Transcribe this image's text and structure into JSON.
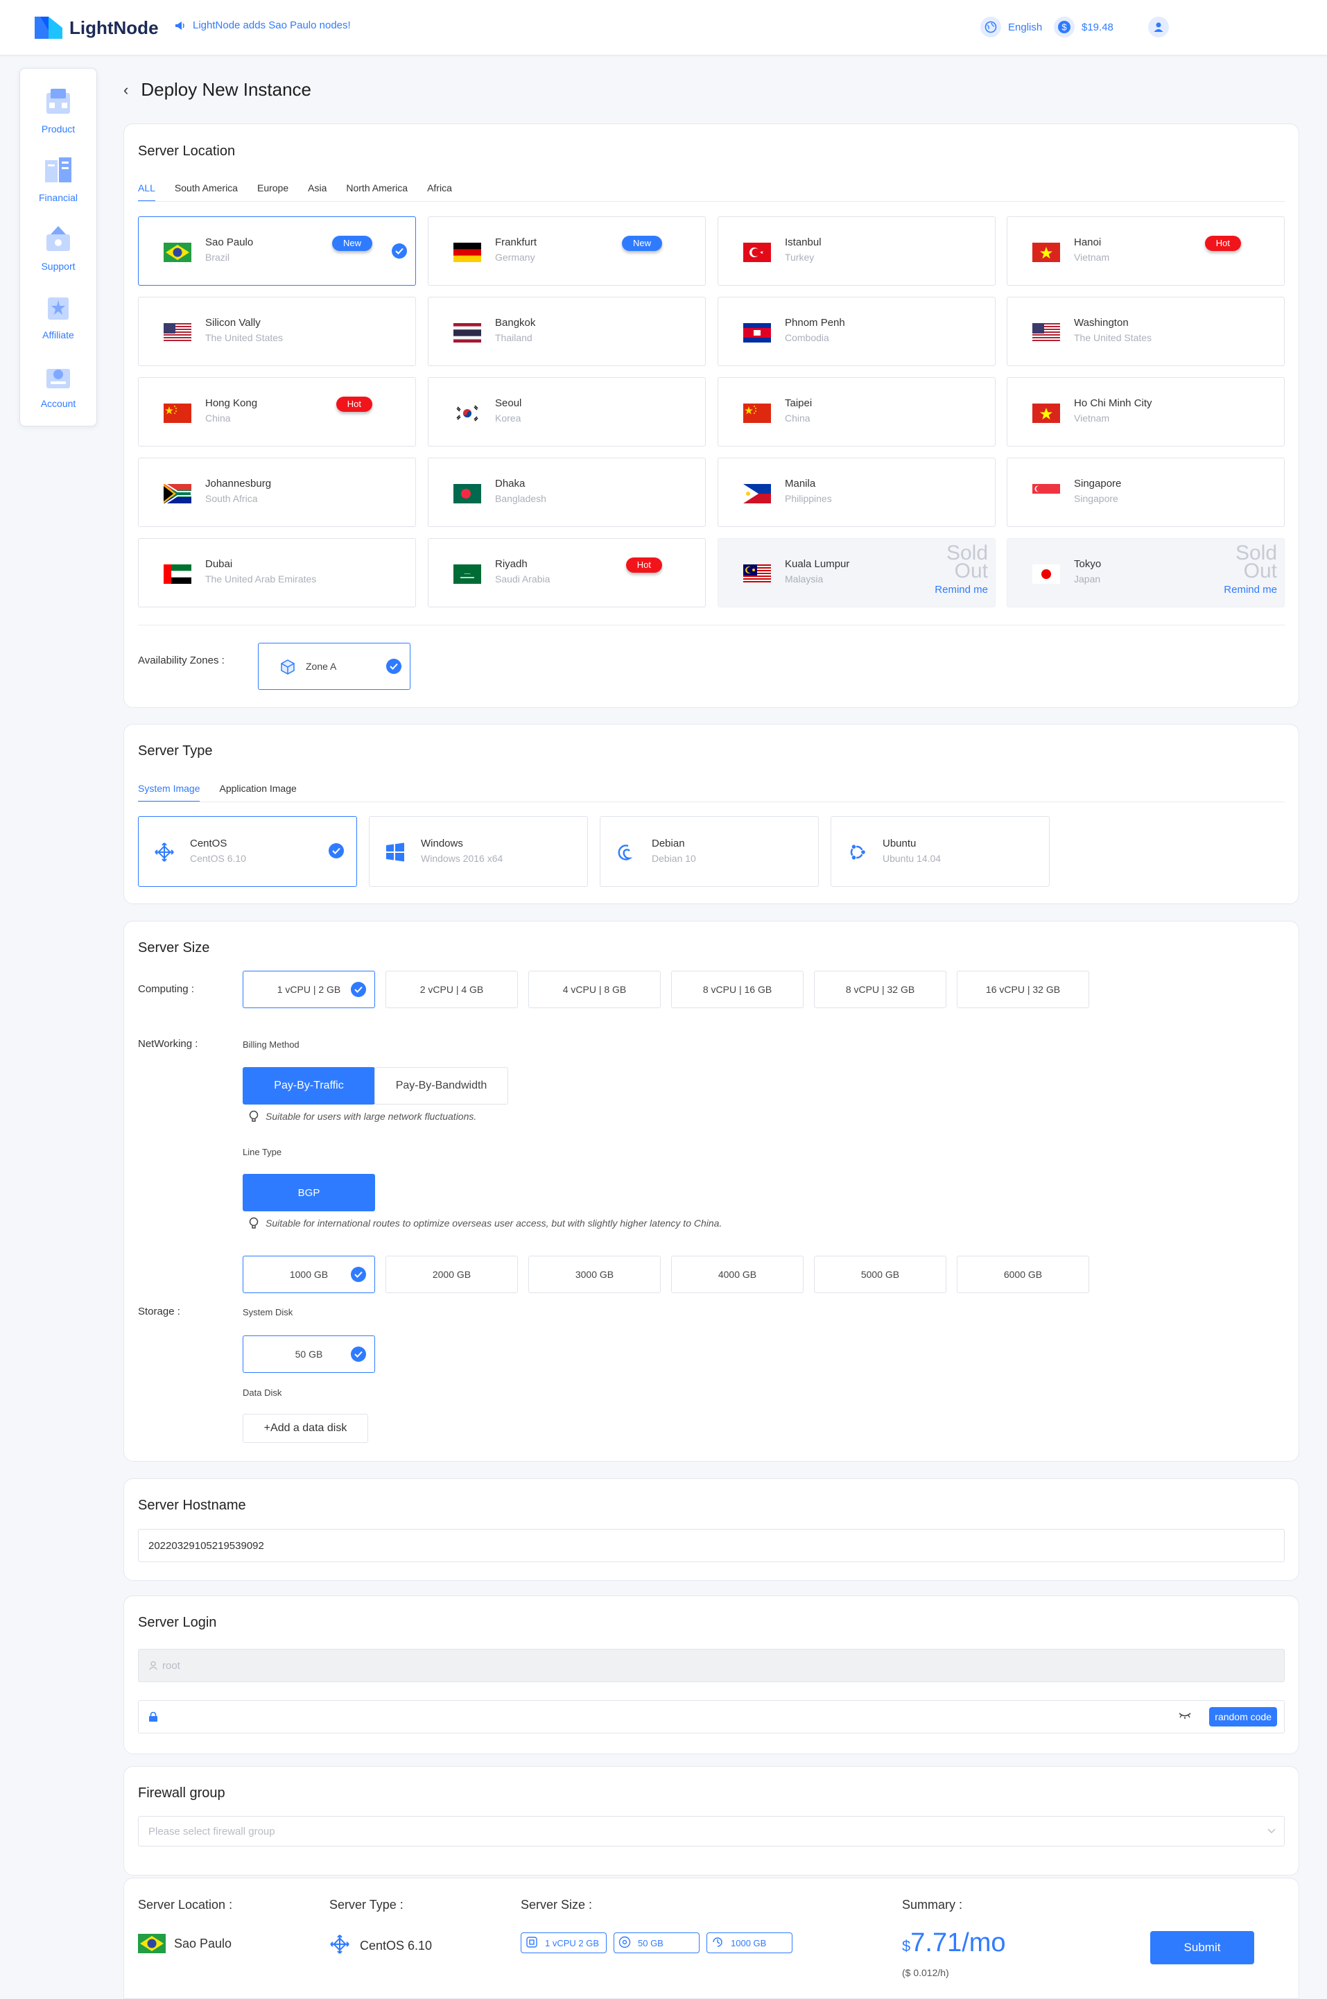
{
  "header": {
    "logo": "LightNode",
    "notice": "LightNode adds Sao Paulo nodes!",
    "language": "English",
    "balance": "$19.48"
  },
  "sidebar": {
    "items": [
      {
        "label": "Product",
        "icon": "product-icon"
      },
      {
        "label": "Financial",
        "icon": "financial-icon"
      },
      {
        "label": "Support",
        "icon": "support-icon"
      },
      {
        "label": "Affiliate",
        "icon": "affiliate-icon"
      },
      {
        "label": "Account",
        "icon": "account-icon"
      }
    ]
  },
  "page": {
    "title": "Deploy New Instance"
  },
  "location": {
    "title": "Server Location",
    "tabs": [
      "ALL",
      "South America",
      "Europe",
      "Asia",
      "North America",
      "Africa"
    ],
    "active_tab": "ALL",
    "sold_out_label": "Sold Out",
    "remind_label": "Remind me",
    "items": [
      {
        "name": "Sao Paulo",
        "country": "Brazil",
        "badge": "New",
        "selected": true,
        "flag": "br"
      },
      {
        "name": "Frankfurt",
        "country": "Germany",
        "badge": "New",
        "flag": "de"
      },
      {
        "name": "Istanbul",
        "country": "Turkey",
        "flag": "tr"
      },
      {
        "name": "Hanoi",
        "country": "Vietnam",
        "badge": "Hot",
        "flag": "vn"
      },
      {
        "name": "Silicon Vally",
        "country": "The United States",
        "flag": "us"
      },
      {
        "name": "Bangkok",
        "country": "Thailand",
        "flag": "th"
      },
      {
        "name": "Phnom Penh",
        "country": "Combodia",
        "flag": "kh"
      },
      {
        "name": "Washington",
        "country": "The United States",
        "flag": "us"
      },
      {
        "name": "Hong Kong",
        "country": "China",
        "badge": "Hot",
        "flag": "cn"
      },
      {
        "name": "Seoul",
        "country": "Korea",
        "flag": "kr"
      },
      {
        "name": "Taipei",
        "country": "China",
        "flag": "cn"
      },
      {
        "name": "Ho Chi Minh City",
        "country": "Vietnam",
        "flag": "vn"
      },
      {
        "name": "Johannesburg",
        "country": "South Africa",
        "flag": "za"
      },
      {
        "name": "Dhaka",
        "country": "Bangladesh",
        "flag": "bd"
      },
      {
        "name": "Manila",
        "country": "Philippines",
        "flag": "ph"
      },
      {
        "name": "Singapore",
        "country": "Singapore",
        "flag": "sg"
      },
      {
        "name": "Dubai",
        "country": "The United Arab Emirates",
        "flag": "ae"
      },
      {
        "name": "Riyadh",
        "country": "Saudi Arabia",
        "badge": "Hot",
        "flag": "sa"
      },
      {
        "name": "Kuala Lumpur",
        "country": "Malaysia",
        "sold_out": true,
        "flag": "my"
      },
      {
        "name": "Tokyo",
        "country": "Japan",
        "sold_out": true,
        "flag": "jp"
      }
    ],
    "zones_label": "Availability Zones :",
    "zone": "Zone A"
  },
  "server_type": {
    "title": "Server Type",
    "tabs": [
      "System Image",
      "Application Image"
    ],
    "images": [
      {
        "name": "CentOS",
        "version": "CentOS 6.10",
        "icon": "centos-icon",
        "selected": true
      },
      {
        "name": "Windows",
        "version": "Windows 2016 x64",
        "icon": "windows-icon"
      },
      {
        "name": "Debian",
        "version": "Debian 10",
        "icon": "debian-icon"
      },
      {
        "name": "Ubuntu",
        "version": "Ubuntu 14.04",
        "icon": "ubuntu-icon"
      }
    ]
  },
  "server_size": {
    "title": "Server Size",
    "computing_label": "Computing :",
    "computing": [
      "1 vCPU | 2 GB",
      "2 vCPU | 4 GB",
      "4 vCPU | 8 GB",
      "8 vCPU | 16 GB",
      "8 vCPU | 32 GB",
      "16 vCPU | 32 GB"
    ],
    "networking_label": "NetWorking :",
    "billing_label": "Billing Method",
    "billing": [
      "Pay-By-Traffic",
      "Pay-By-Bandwidth"
    ],
    "billing_hint": "Suitable for users with large network fluctuations.",
    "line_type_label": "Line Type",
    "line_type": "BGP",
    "line_hint": "Suitable for international routes to optimize overseas user access, but with slightly higher latency to China.",
    "traffic": [
      "1000 GB",
      "2000 GB",
      "3000 GB",
      "4000 GB",
      "5000 GB",
      "6000 GB"
    ],
    "storage_label": "Storage :",
    "system_disk_label": "System Disk",
    "system_disk": "50 GB",
    "data_disk_label": "Data Disk",
    "add_disk": "+Add a data disk"
  },
  "hostname": {
    "title": "Server Hostname",
    "value": "20220329105219539092"
  },
  "login": {
    "title": "Server Login",
    "user_placeholder": "root",
    "random_code": "random code"
  },
  "firewall": {
    "title": "Firewall group",
    "placeholder": "Please select firewall group"
  },
  "summary": {
    "location_label": "Server Location :",
    "location": "Sao Paulo",
    "type_label": "Server Type :",
    "type": "CentOS 6.10",
    "size_label": "Server Size :",
    "size_pills": [
      "1 vCPU 2 GB",
      "50 GB",
      "1000 GB"
    ],
    "summary_label": "Summary :",
    "price_currency": "$",
    "price": "7.71/mo",
    "price_hourly": "($ 0.012/h)",
    "submit": "Submit"
  },
  "colors": {
    "accent": "#2f7bff",
    "hot": "#f2141b",
    "sold_out_bg": "#f3f5f9"
  }
}
